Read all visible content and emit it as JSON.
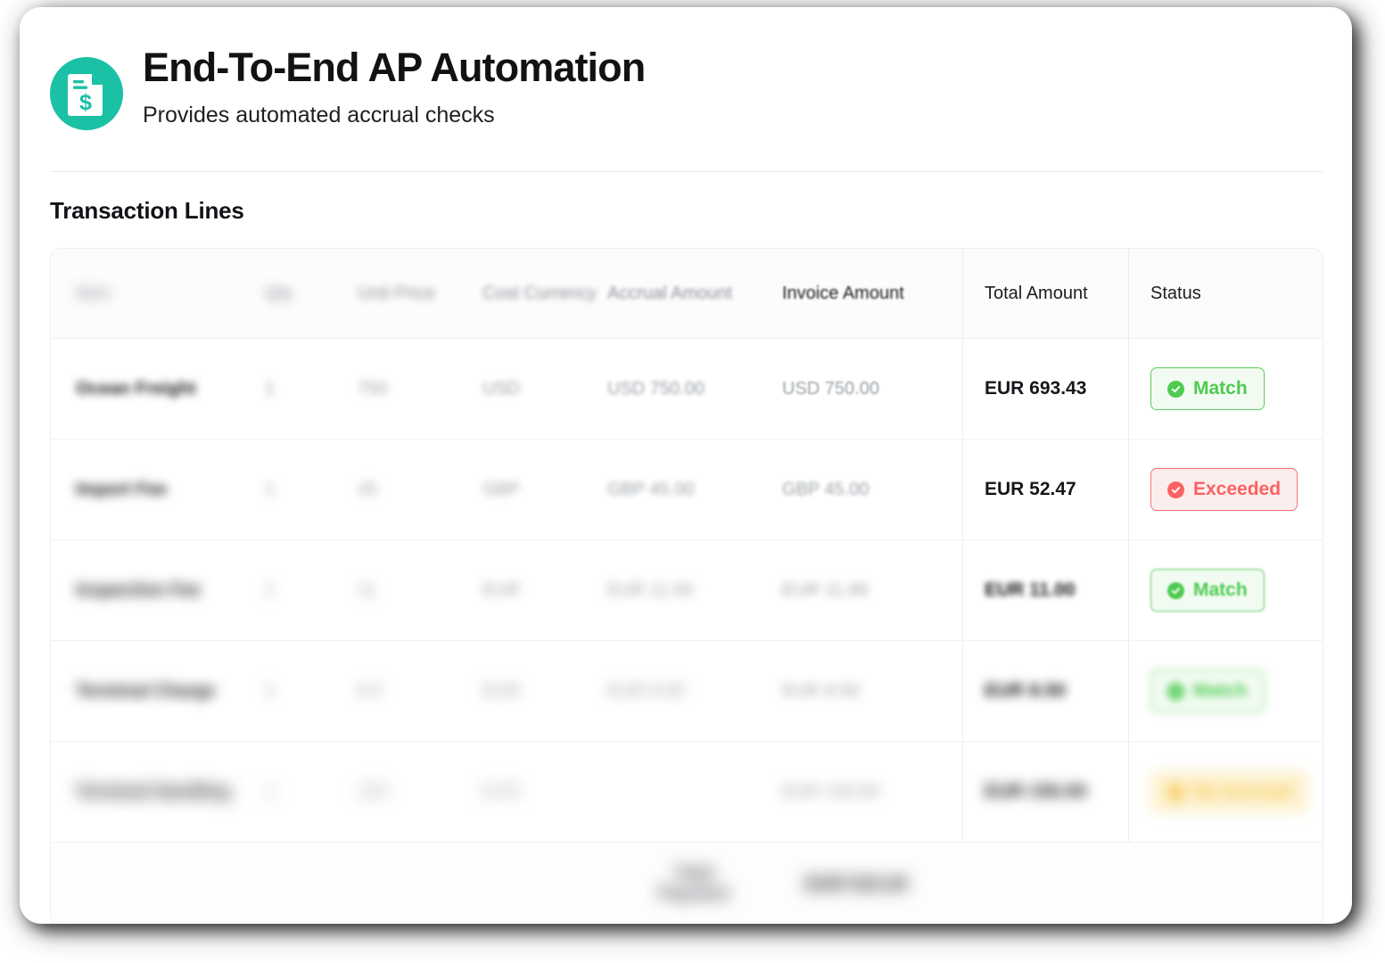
{
  "header": {
    "icon": "invoice-dollar-icon",
    "title": "End-To-End AP Automation",
    "subtitle": "Provides automated accrual checks",
    "accent_color": "#1ac1a4"
  },
  "section": {
    "title": "Transaction Lines"
  },
  "table": {
    "columns": [
      {
        "key": "item",
        "label": "Item"
      },
      {
        "key": "qty",
        "label": "Qty"
      },
      {
        "key": "unit",
        "label": "Unit Price"
      },
      {
        "key": "currency",
        "label": "Cost Currency"
      },
      {
        "key": "accrual",
        "label": "Accrual Amount"
      },
      {
        "key": "invoice",
        "label": "Invoice Amount"
      },
      {
        "key": "total",
        "label": "Total Amount"
      },
      {
        "key": "status",
        "label": "Status"
      }
    ],
    "rows": [
      {
        "item": "Ocean Freight",
        "qty": "1",
        "unit": "750",
        "currency": "USD",
        "accrual": "USD 750.00",
        "invoice": "USD 750.00",
        "total": "EUR 693.43",
        "status": "Match",
        "status_kind": "match"
      },
      {
        "item": "Import Fee",
        "qty": "1",
        "unit": "45",
        "currency": "GBP",
        "accrual": "GBP 45.00",
        "invoice": "GBP 45.00",
        "total": "EUR 52.47",
        "status": "Exceeded",
        "status_kind": "exceeded"
      },
      {
        "item": "Inspection Fee",
        "qty": "1",
        "unit": "11",
        "currency": "EUR",
        "accrual": "EUR 11.00",
        "invoice": "EUR 11.00",
        "total": "EUR 11.00",
        "status": "Match",
        "status_kind": "match"
      },
      {
        "item": "Terminal Charge",
        "qty": "1",
        "unit": "8.5",
        "currency": "EUR",
        "accrual": "EUR 8.50",
        "invoice": "EUR 8.50",
        "total": "EUR 8.50",
        "status": "Match",
        "status_kind": "match"
      },
      {
        "item": "Terminal Handling",
        "qty": "1",
        "unit": "150",
        "currency": "EUR",
        "accrual": "",
        "invoice": "EUR 150.00",
        "total": "EUR 150.00",
        "status": "No Accrual",
        "status_kind": "noaccrual"
      }
    ],
    "total_row": {
      "label_line1": "Total",
      "label_line2": "Payment",
      "amount": "EUR 915.40"
    }
  },
  "status_colors": {
    "match": "#4ecb50",
    "exceeded": "#fb6262",
    "noaccrual": "#f6c74a"
  }
}
